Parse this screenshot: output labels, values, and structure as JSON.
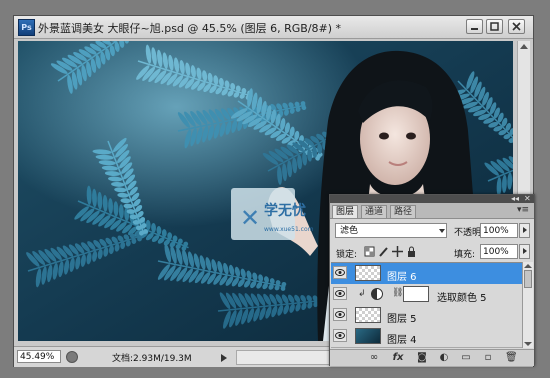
{
  "app": {
    "icon_text": "Ps"
  },
  "document": {
    "title": "外景蓝调美女  大眼仔~旭.psd @ 45.5% (图层 6, RGB/8#) *"
  },
  "window_buttons": [
    "minimize-icon",
    "maximize-icon",
    "close-icon"
  ],
  "watermark": {
    "text": "学无忧",
    "url_text": "www.xue51.com"
  },
  "status_bar": {
    "zoom": "45.49%",
    "doc_size": "文档:2.93M/19.3M"
  },
  "layers_panel": {
    "tabs": [
      {
        "label": "图层",
        "active": true
      },
      {
        "label": "通道",
        "active": false
      },
      {
        "label": "路径",
        "active": false
      }
    ],
    "blend_mode": "滤色",
    "opacity_label": "不透明度:",
    "opacity_value": "100%",
    "lock_label": "锁定:",
    "fill_label": "填充:",
    "fill_value": "100%",
    "layers": [
      {
        "name": "图层 6",
        "selected": true,
        "visible": true,
        "kind": "pixel"
      },
      {
        "name": "选取颜色 5",
        "selected": false,
        "visible": true,
        "kind": "adjustment"
      },
      {
        "name": "图层 5",
        "selected": false,
        "visible": true,
        "kind": "pixel"
      },
      {
        "name": "图层 4",
        "selected": false,
        "visible": true,
        "kind": "photo"
      }
    ],
    "bottom_icons": [
      "link-icon",
      "fx-icon",
      "mask-icon",
      "adjustment-icon",
      "group-icon",
      "new-layer-icon",
      "trash-icon"
    ],
    "colors": {
      "selection": "#3d8ee0"
    }
  }
}
